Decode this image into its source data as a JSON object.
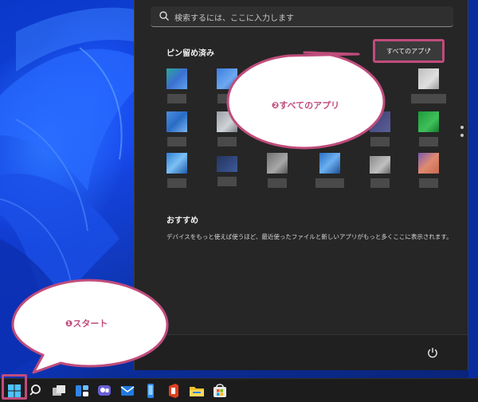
{
  "search": {
    "placeholder": "検索するには、ここに入力します"
  },
  "pinned": {
    "title": "ピン留め済み",
    "all_apps_label": "すべてのアプリ",
    "all_apps_chevron": "›"
  },
  "recommended": {
    "title": "おすすめ",
    "text": "デバイスをもっと使えば使うほど、最近使ったファイルと新しいアプリがもっと多くここに表示されます。"
  },
  "callouts": {
    "all_apps": "❷すべてのアプリ",
    "start": "❶スタート"
  },
  "colors": {
    "accent": "#c04c7c",
    "menu_bg": "#262626",
    "taskbar_bg": "#1c1c1c"
  },
  "taskbar": {
    "icons": [
      "start-icon",
      "search-icon",
      "task-view-icon",
      "widgets-icon",
      "chat-icon",
      "mail-icon",
      "phone-icon",
      "office-icon",
      "file-explorer-icon",
      "store-icon"
    ]
  },
  "pinned_apps": [
    "app-1",
    "app-2",
    "app-3",
    "app-4",
    "app-5",
    "app-6",
    "app-7",
    "app-8",
    "app-9",
    "app-10",
    "app-11",
    "app-12",
    "app-13",
    "app-14",
    "app-15",
    "app-16",
    "app-17",
    "app-18"
  ]
}
